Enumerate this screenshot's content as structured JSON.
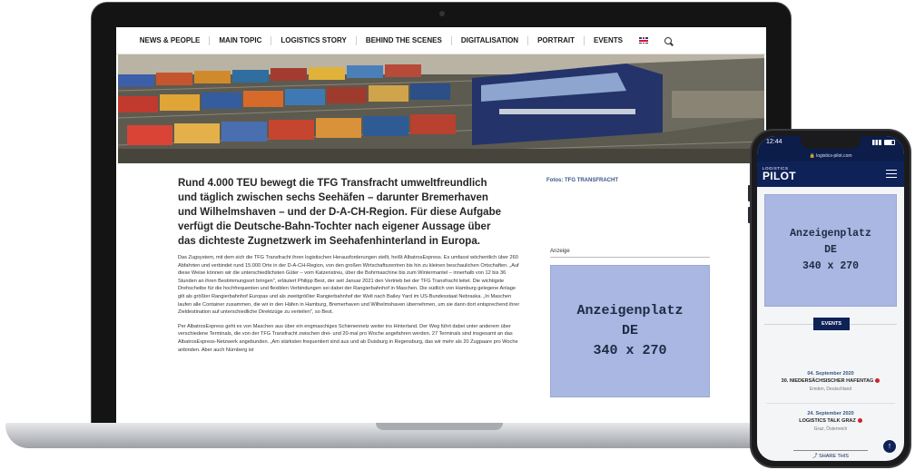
{
  "laptop": {
    "nav": {
      "items": [
        "NEWS & PEOPLE",
        "MAIN TOPIC",
        "LOGISTICS STORY",
        "BEHIND THE SCENES",
        "DIGITALISATION",
        "PORTRAIT",
        "EVENTS"
      ]
    },
    "article": {
      "lead": "Rund 4.000 TEU bewegt die TFG Transfracht umweltfreundlich und täglich zwischen sechs Seehäfen – darunter Bremerhaven und Wilhelmshaven – und der D-A-CH-Region. Für diese Aufgabe verfügt die Deutsche-Bahn-Tochter nach eigener Aussage über das dichteste Zugnetzwerk im Seehafenhinterland in Europa.",
      "paragraph_1": "Das Zugsystem, mit dem sich die TFG Transfracht ihren logistischen Herausforderungen stellt, heißt AlbatrosExpress. Es umfasst wöchentlich über 260 Abfahrten und verbindet rund 15.000 Orte in der D-A-CH-Region, von den großen Wirtschaftszentren bis hin zu kleinen beschaulichen Ortschaften. „Auf diese Weise können wir die unterschiedlichsten Güter – vom Katzenstreu, über die Bohrmaschine bis zum Wintermantel – innerhalb von 12 bis 36 Stunden an ihren Bestimmungsort bringen\", erläutert Philipp Best, der seit Januar 2021 den Vertrieb bei der TFG Transfracht leitet. Die wichtigste Drehscheibe für die hochfrequenten und flexiblen Verbindungen sei dabei der Rangierbahnhof in Maschen. Die südlich von Hamburg gelegene Anlage gilt als größter Rangierbahnhof Europas und als zweitgrößter Rangierbahnhof der Welt nach Bailey Yard im US-Bundesstaat Nebraska. „In Maschen laufen alle Container zusammen, die wir in den Häfen in Hamburg, Bremerhaven und Wilhelmshaven übernehmen, um sie dann dort entsprechend ihrer Zieldestination auf unterschiedliche Direktzüge zu verteilen\", so Best.",
      "paragraph_2": "Per AlbatrosExpress geht es von Maschen aus über ein engmaschiges Schienennetz weiter ins Hinterland. Der Weg führt dabei unter anderem über verschiedene Terminals, die von der TFG Transfracht zwischen drei- und 20-mal pro Woche angefahren werden. 27 Terminals sind insgesamt an das AlbatrosExpress-Netzwerk angebunden. „Am stärksten frequentiert sind aus und ab Duisburg in Regensburg, das wir mehr als 20 Zugpaare pro Woche anbinden. Aber auch Nürnberg ist"
    },
    "sidebar": {
      "photo_credit": "Fotos: TFG TRANSFRACHT",
      "ad_label": "Anzeige",
      "ad_line_1": "Anzeigenplatz",
      "ad_line_2": "DE",
      "ad_line_3": "340 x 270"
    }
  },
  "phone": {
    "status_time": "12:44",
    "url": "logistics-pilot.com",
    "logo_top": "LOGISTICS",
    "logo_bottom": "PILOT",
    "ad_line_1": "Anzeigenplatz",
    "ad_line_2": "DE",
    "ad_line_3": "340 x 270",
    "events_tab": "EVENTS",
    "events": [
      {
        "date": "04. September 2020",
        "title": "30. NIEDERSÄCHSISCHER HAFENTAG",
        "place": "Emden, Deutschland"
      },
      {
        "date": "24. September 2020",
        "title": "LOGISTICS TALK GRAZ",
        "place": "Graz, Österreich"
      }
    ],
    "share_label": "SHARE THIS",
    "colors": {
      "header": "#0f2258",
      "ad_bg": "#aab7e2",
      "event_dot": "#d0232b"
    }
  }
}
